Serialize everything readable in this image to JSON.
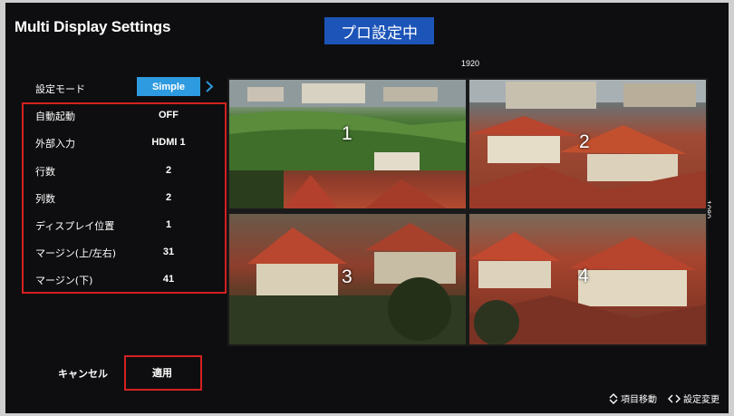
{
  "header": {
    "title": "Multi Display Settings",
    "badge": "プロ設定中"
  },
  "mode": {
    "label": "設定モード",
    "value": "Simple"
  },
  "settings": [
    {
      "label": "自動起動",
      "value": "OFF"
    },
    {
      "label": "外部入力",
      "value": "HDMI 1"
    },
    {
      "label": "行数",
      "value": "2"
    },
    {
      "label": "列数",
      "value": "2"
    },
    {
      "label": "ディスプレイ位置",
      "value": "1"
    },
    {
      "label": "マージン(上/左右)",
      "value": "31"
    },
    {
      "label": "マージン(下)",
      "value": "41"
    }
  ],
  "preview": {
    "width_label": "1920",
    "height_label": "1080",
    "tiles": [
      "1",
      "2",
      "3",
      "4"
    ]
  },
  "buttons": {
    "cancel": "キャンセル",
    "apply": "適用"
  },
  "hints": {
    "move": "項目移動",
    "change": "設定変更"
  },
  "icons": {
    "nav": "chevron-right-icon",
    "updown": "up-down-icon",
    "leftright": "left-right-icon"
  },
  "colors": {
    "accent": "#2e9be0",
    "banner": "#1c54b8",
    "highlight": "#d42020"
  }
}
